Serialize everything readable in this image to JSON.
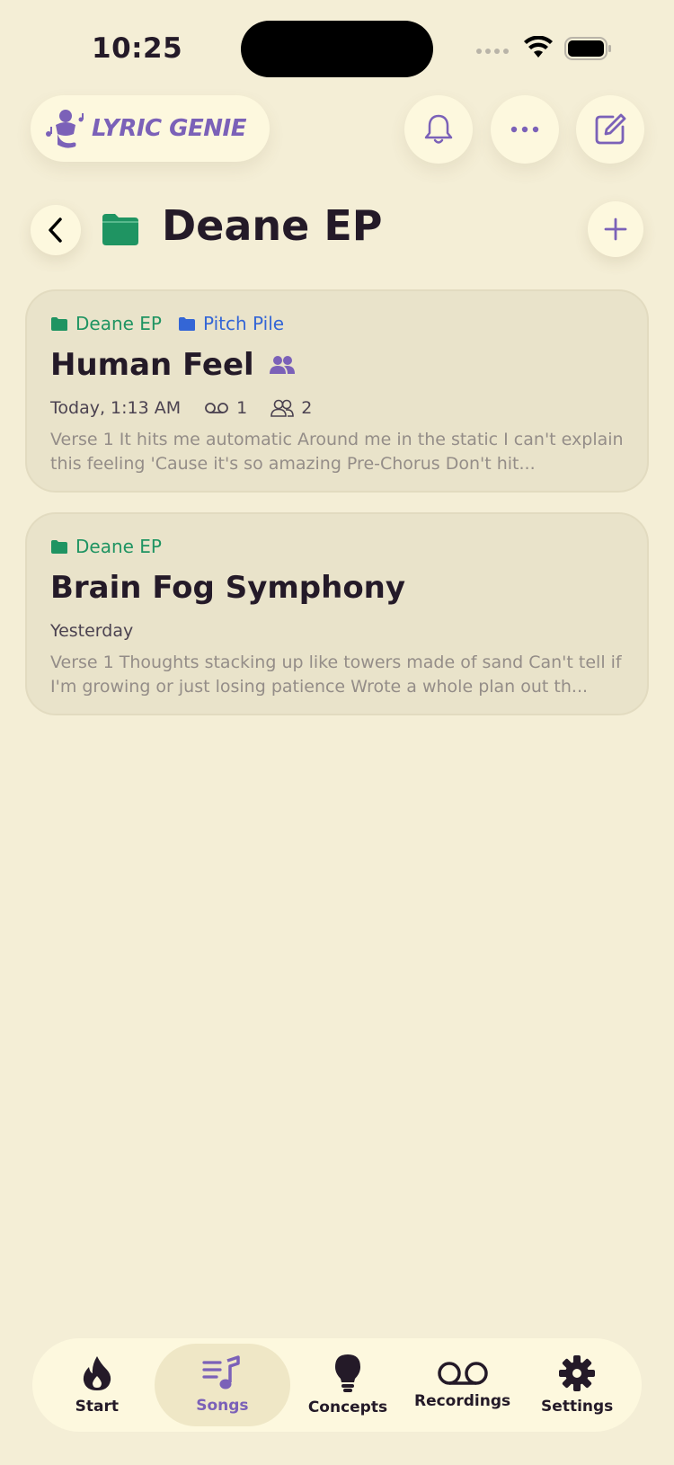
{
  "status_bar": {
    "time": "10:25"
  },
  "app": {
    "logo_text": "LYRIC GENIE"
  },
  "header": {
    "title": "Deane EP"
  },
  "songs": [
    {
      "folders": [
        {
          "name": "Deane EP",
          "color": "#1f9462"
        },
        {
          "name": "Pitch Pile",
          "color": "#3466d6"
        }
      ],
      "title": "Human Feel",
      "shared": true,
      "date": "Today, 1:13 AM",
      "recordings": "1",
      "collaborators": "2",
      "preview": "Verse 1 It hits me automatic Around me in the static I can't explain this feeling 'Cause it's so amazing Pre-Chorus Don't hit..."
    },
    {
      "folders": [
        {
          "name": "Deane EP",
          "color": "#1f9462"
        }
      ],
      "title": "Brain Fog Symphony",
      "shared": false,
      "date": "Yesterday",
      "preview": "Verse 1 Thoughts stacking up like towers made of sand Can't tell if I'm growing or just losing patience Wrote a whole plan out th..."
    }
  ],
  "tabs": [
    {
      "label": "Start",
      "icon": "flame-icon",
      "active": false
    },
    {
      "label": "Songs",
      "icon": "music-list-icon",
      "active": true
    },
    {
      "label": "Concepts",
      "icon": "lightbulb-icon",
      "active": false
    },
    {
      "label": "Recordings",
      "icon": "voicemail-icon",
      "active": false
    },
    {
      "label": "Settings",
      "icon": "gear-icon",
      "active": false
    }
  ],
  "colors": {
    "background": "#f4eed6",
    "accent": "#7b61b8",
    "folder_green": "#1f9462",
    "folder_blue": "#3466d6",
    "card": "#e9e3ca"
  }
}
